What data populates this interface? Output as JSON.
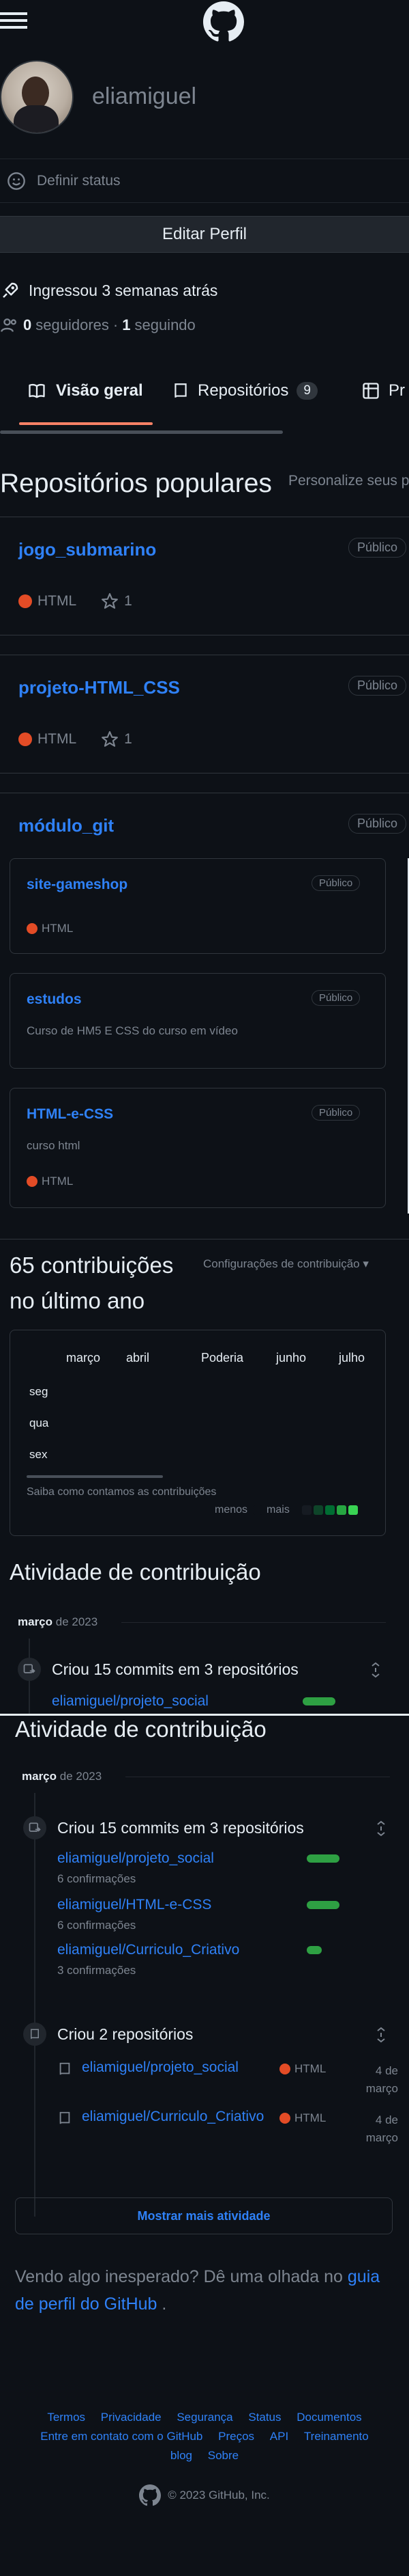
{
  "header": {
    "menu_icon": "hamburger-menu-icon",
    "logo_icon": "github-logo-icon"
  },
  "profile": {
    "username": "eliamiguel",
    "status_label": "Definir status",
    "edit_button": "Editar Perfil",
    "joined": "Ingressou 3 semanas atrás",
    "followers_count": "0",
    "followers_label": "seguidores",
    "separator": "·",
    "following_count": "1",
    "following_label": "seguindo"
  },
  "tabs": [
    {
      "label": "Visão geral",
      "icon": "book-icon",
      "active": true
    },
    {
      "label": "Repositórios",
      "icon": "repo-icon",
      "count": "9"
    },
    {
      "label": "Pr",
      "icon": "project-icon"
    }
  ],
  "popular": {
    "title": "Repositórios populares",
    "customize": "Personalize seus p",
    "repos": [
      {
        "name": "jogo_submarino",
        "badge": "Público",
        "language": "HTML",
        "stars": "1"
      },
      {
        "name": "projeto-HTML_CSS",
        "badge": "Público",
        "language": "HTML",
        "stars": "1"
      },
      {
        "name": "módulo_git",
        "badge": "Público"
      }
    ],
    "inner_repos": [
      {
        "name": "site-gameshop",
        "badge": "Público",
        "description": "",
        "language": "HTML"
      },
      {
        "name": "estudos",
        "badge": "Público",
        "description": "Curso de HM5 E CSS do curso em vídeo",
        "language": ""
      },
      {
        "name": "HTML-e-CSS",
        "badge": "Público",
        "description": "curso html",
        "language": "HTML"
      }
    ]
  },
  "contributions": {
    "title_line1": "65 contribuições",
    "title_line2": "no último ano",
    "settings": "Configurações de contribuição ▾",
    "months": [
      "março",
      "abril",
      "Poderia",
      "junho",
      "julho"
    ],
    "days": [
      "seg",
      "qua",
      "sex"
    ],
    "learn": "Saiba como contamos as contribuições",
    "less": "menos",
    "more": "mais",
    "legend_colors": [
      "#161b22",
      "#0e4429",
      "#006d32",
      "#26a641",
      "#39d353"
    ]
  },
  "activity_preview": {
    "title": "Atividade de contribuição",
    "month": "março",
    "year": "de 2023",
    "commits_title": "Criou 15 commits em 3 repositórios",
    "first_repo": "eliamiguel/projeto_social"
  },
  "activity": {
    "title": "Atividade de contribuição",
    "month": "março",
    "year": "de 2023",
    "commits_title": "Criou 15 commits em 3 repositórios",
    "commits": [
      {
        "repo": "eliamiguel/projeto_social",
        "count": "6 confirmações",
        "share": 1.0
      },
      {
        "repo": "eliamiguel/HTML-e-CSS",
        "count": "6 confirmações",
        "share": 1.0
      },
      {
        "repo": "eliamiguel/Curriculo_Criativo",
        "count": "3 confirmações",
        "share": 0.45
      }
    ],
    "created_title": "Criou 2 repositórios",
    "created": [
      {
        "repo": "eliamiguel/projeto_social",
        "language": "HTML",
        "date_line1": "4 de",
        "date_line2": "março"
      },
      {
        "repo": "eliamiguel/Curriculo_Criativo",
        "language": "HTML",
        "date_line1": "4 de",
        "date_line2": "março"
      }
    ],
    "show_more": "Mostrar mais atividade"
  },
  "unexpected": {
    "text": "Vendo algo inesperado? Dê uma olhada no ",
    "link": "guia de perfil do GitHub",
    "end": " ."
  },
  "footer": {
    "links_row1": [
      "Termos",
      "Privacidade",
      "Segurança",
      "Status",
      "Documentos"
    ],
    "links_row2": [
      "Entre em contato com o GitHub",
      "Preços",
      "API",
      "Treinamento"
    ],
    "links_row3": [
      "blog",
      "Sobre"
    ],
    "copyright": "© 2023 GitHub, Inc."
  },
  "colors": {
    "background": "#0d1117",
    "link": "#2f81f7",
    "tab_underline": "#f78166",
    "language_html": "#e34c26",
    "commit_bar": "#2ea043"
  }
}
